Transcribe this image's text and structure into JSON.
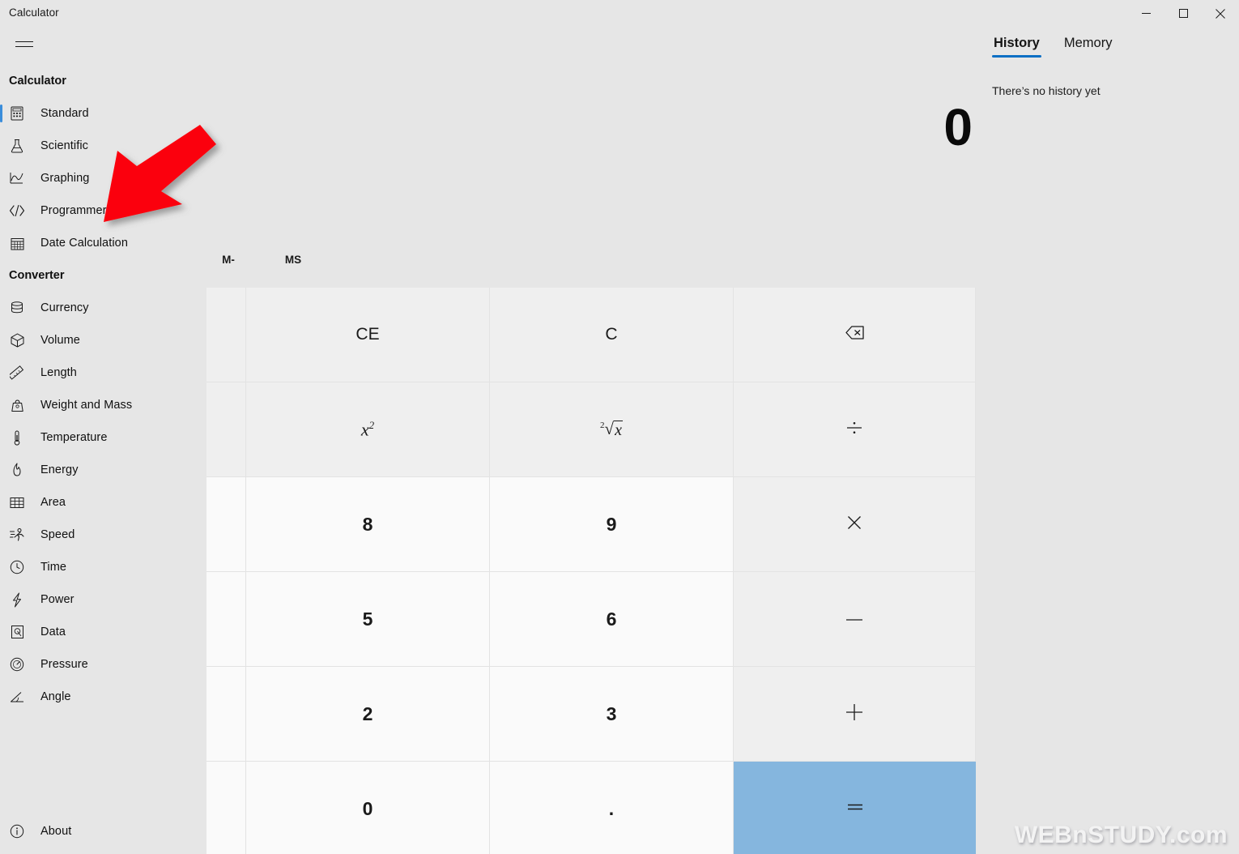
{
  "window": {
    "title": "Calculator",
    "controls": [
      {
        "name": "minimize",
        "glyph": "minimize-icon"
      },
      {
        "name": "maximize",
        "glyph": "maximize-icon"
      },
      {
        "name": "close",
        "glyph": "close-icon"
      }
    ]
  },
  "nav": {
    "menu_icon": "hamburger-icon",
    "sections": [
      {
        "header": "Calculator",
        "items": [
          {
            "label": "Standard",
            "icon": "calculator-icon",
            "selected": true
          },
          {
            "label": "Scientific",
            "icon": "flask-icon",
            "selected": false
          },
          {
            "label": "Graphing",
            "icon": "graph-icon",
            "selected": false
          },
          {
            "label": "Programmer",
            "icon": "code-icon",
            "selected": false
          },
          {
            "label": "Date Calculation",
            "icon": "calendar-icon",
            "selected": false
          }
        ]
      },
      {
        "header": "Converter",
        "items": [
          {
            "label": "Currency",
            "icon": "coins-icon",
            "selected": false
          },
          {
            "label": "Volume",
            "icon": "cube-icon",
            "selected": false
          },
          {
            "label": "Length",
            "icon": "ruler-icon",
            "selected": false
          },
          {
            "label": "Weight and Mass",
            "icon": "weight-icon",
            "selected": false
          },
          {
            "label": "Temperature",
            "icon": "thermometer-icon",
            "selected": false
          },
          {
            "label": "Energy",
            "icon": "flame-icon",
            "selected": false
          },
          {
            "label": "Area",
            "icon": "grid-icon",
            "selected": false
          },
          {
            "label": "Speed",
            "icon": "runner-icon",
            "selected": false
          },
          {
            "label": "Time",
            "icon": "clock-icon",
            "selected": false
          },
          {
            "label": "Power",
            "icon": "bolt-icon",
            "selected": false
          },
          {
            "label": "Data",
            "icon": "data-icon",
            "selected": false
          },
          {
            "label": "Pressure",
            "icon": "gauge-icon",
            "selected": false
          },
          {
            "label": "Angle",
            "icon": "angle-icon",
            "selected": false
          }
        ]
      }
    ],
    "about": {
      "label": "About",
      "icon": "info-icon"
    }
  },
  "display": {
    "value": "0"
  },
  "memory_buttons": [
    {
      "label": "M-",
      "name": "memory-subtract"
    },
    {
      "label": "MS",
      "name": "memory-store"
    }
  ],
  "keypad": {
    "rows": [
      [
        {
          "label": "",
          "name": "partial-button-row1",
          "kind": "op",
          "partial": true
        },
        {
          "label": "CE",
          "name": "clear-entry-button",
          "kind": "op"
        },
        {
          "label": "C",
          "name": "clear-button",
          "kind": "op"
        },
        {
          "label": "",
          "name": "backspace-button",
          "kind": "op",
          "icon": "backspace-icon"
        }
      ],
      [
        {
          "label": "",
          "name": "partial-button-row2",
          "kind": "op",
          "partial": true
        },
        {
          "label": "x²",
          "name": "square-button",
          "kind": "op",
          "icon": "x-squared-icon"
        },
        {
          "label": "²√x",
          "name": "square-root-button",
          "kind": "op",
          "icon": "square-root-icon"
        },
        {
          "label": "÷",
          "name": "divide-button",
          "kind": "op",
          "icon": "divide-icon"
        }
      ],
      [
        {
          "label": "",
          "name": "partial-button-row3",
          "kind": "num",
          "partial": true
        },
        {
          "label": "8",
          "name": "digit-8-button",
          "kind": "num"
        },
        {
          "label": "9",
          "name": "digit-9-button",
          "kind": "num"
        },
        {
          "label": "×",
          "name": "multiply-button",
          "kind": "op",
          "icon": "multiply-icon"
        }
      ],
      [
        {
          "label": "",
          "name": "partial-button-row4",
          "kind": "num",
          "partial": true
        },
        {
          "label": "5",
          "name": "digit-5-button",
          "kind": "num"
        },
        {
          "label": "6",
          "name": "digit-6-button",
          "kind": "num"
        },
        {
          "label": "−",
          "name": "subtract-button",
          "kind": "op",
          "icon": "minus-icon"
        }
      ],
      [
        {
          "label": "",
          "name": "partial-button-row5",
          "kind": "num",
          "partial": true
        },
        {
          "label": "2",
          "name": "digit-2-button",
          "kind": "num"
        },
        {
          "label": "3",
          "name": "digit-3-button",
          "kind": "num"
        },
        {
          "label": "+",
          "name": "add-button",
          "kind": "op",
          "icon": "plus-icon"
        }
      ],
      [
        {
          "label": "",
          "name": "partial-button-row6",
          "kind": "num",
          "partial": true
        },
        {
          "label": "0",
          "name": "digit-0-button",
          "kind": "num"
        },
        {
          "label": ".",
          "name": "decimal-point-button",
          "kind": "num"
        },
        {
          "label": "=",
          "name": "equals-button",
          "kind": "eq",
          "icon": "equals-icon"
        }
      ]
    ]
  },
  "right_panel": {
    "tabs": [
      {
        "label": "History",
        "active": true
      },
      {
        "label": "Memory",
        "active": false
      }
    ],
    "empty_message": "There’s no history yet"
  },
  "annotation": {
    "arrow_color": "#fb0007",
    "points_to": "Programmer"
  },
  "watermark": {
    "text": "WEBnSTUDY.com"
  },
  "colors": {
    "window_background": "#e6e6e6",
    "number_button": "#fafafa",
    "operator_button": "#efefef",
    "equals_button": "#85b6de",
    "accent": "#0b6fc4",
    "selection_bar": "#3a8ddb"
  }
}
